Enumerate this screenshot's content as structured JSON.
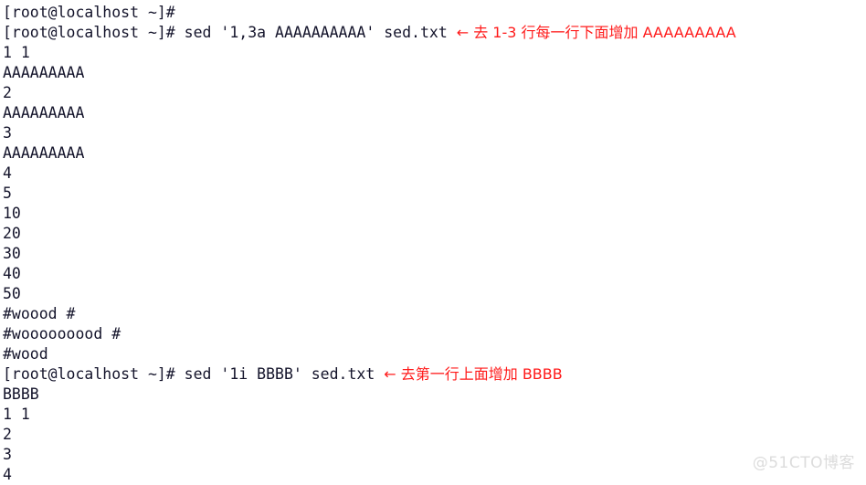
{
  "terminal": {
    "background_color": "#ffffff",
    "text_color": "#14142b",
    "annotation_color": "#ff1a1a",
    "prompt": "[root@localhost ~]# ",
    "lines": [
      {
        "type": "prompt",
        "text": "[root@localhost ~]# "
      },
      {
        "type": "command",
        "text": "[root@localhost ~]# sed '1,3a AAAAAAAAAA' sed.txt ",
        "annotation": "← 去 1-3 行每一行下面增加 AAAAAAAAA"
      },
      {
        "type": "output",
        "text": "1 1"
      },
      {
        "type": "output",
        "text": "AAAAAAAAA"
      },
      {
        "type": "output",
        "text": "2"
      },
      {
        "type": "output",
        "text": "AAAAAAAAA"
      },
      {
        "type": "output",
        "text": "3"
      },
      {
        "type": "output",
        "text": "AAAAAAAAA"
      },
      {
        "type": "output",
        "text": "4"
      },
      {
        "type": "output",
        "text": "5"
      },
      {
        "type": "output",
        "text": "10"
      },
      {
        "type": "output",
        "text": "20"
      },
      {
        "type": "output",
        "text": "30"
      },
      {
        "type": "output",
        "text": "40"
      },
      {
        "type": "output",
        "text": "50"
      },
      {
        "type": "output",
        "text": "#woood #"
      },
      {
        "type": "output",
        "text": "#wooooooood #"
      },
      {
        "type": "output",
        "text": "#wood"
      },
      {
        "type": "command",
        "text": "[root@localhost ~]# sed '1i BBBB' sed.txt ",
        "annotation": "← 去第一行上面增加 BBBB"
      },
      {
        "type": "output",
        "text": "BBBB"
      },
      {
        "type": "output",
        "text": "1 1"
      },
      {
        "type": "output",
        "text": "2"
      },
      {
        "type": "output",
        "text": "3"
      },
      {
        "type": "output",
        "text": "4"
      }
    ]
  },
  "watermark": {
    "text": "@51CTO博客"
  }
}
